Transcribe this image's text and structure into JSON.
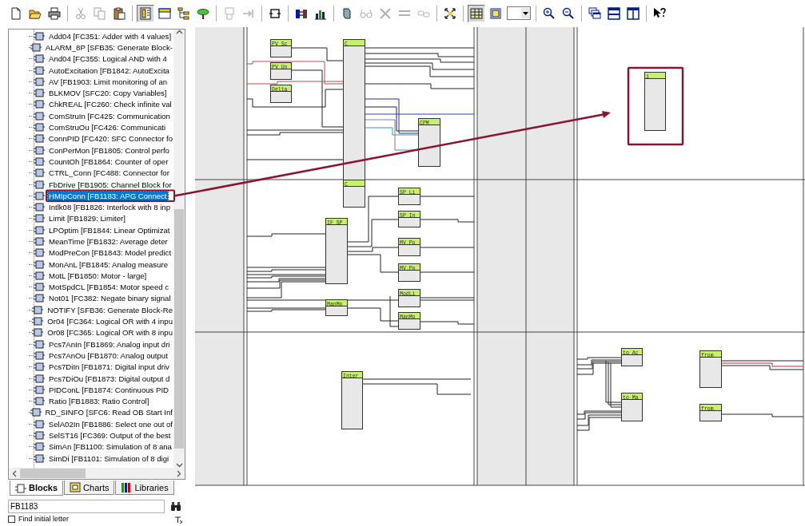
{
  "toolbar": [
    {
      "kind": "new",
      "disabled": false,
      "pressed": false
    },
    {
      "kind": "open",
      "disabled": false,
      "pressed": false
    },
    {
      "kind": "print",
      "disabled": false,
      "pressed": false
    },
    {
      "kind": "separator"
    },
    {
      "kind": "cut",
      "disabled": true,
      "pressed": false
    },
    {
      "kind": "copy",
      "disabled": true,
      "pressed": false
    },
    {
      "kind": "paste",
      "disabled": false,
      "pressed": false
    },
    {
      "kind": "separator"
    },
    {
      "kind": "catalog",
      "disabled": false,
      "pressed": true
    },
    {
      "kind": "window",
      "disabled": false,
      "pressed": false
    },
    {
      "kind": "tree",
      "disabled": false,
      "pressed": false
    },
    {
      "kind": "pin",
      "disabled": false,
      "pressed": false
    },
    {
      "kind": "separator"
    },
    {
      "kind": "stamp",
      "disabled": true,
      "pressed": false
    },
    {
      "kind": "arrowbar",
      "disabled": true,
      "pressed": false
    },
    {
      "kind": "separator"
    },
    {
      "kind": "loop",
      "disabled": false,
      "pressed": false
    },
    {
      "kind": "separator"
    },
    {
      "kind": "connector",
      "disabled": false,
      "pressed": false
    },
    {
      "kind": "chart",
      "disabled": false,
      "pressed": false
    },
    {
      "kind": "separator"
    },
    {
      "kind": "eraser",
      "disabled": false,
      "pressed": false
    },
    {
      "kind": "glasses",
      "disabled": true,
      "pressed": false
    },
    {
      "kind": "cross",
      "disabled": true,
      "pressed": false
    },
    {
      "kind": "line",
      "disabled": true,
      "pressed": false
    },
    {
      "kind": "chain",
      "disabled": true,
      "pressed": false
    },
    {
      "kind": "separator"
    },
    {
      "kind": "expand",
      "disabled": false,
      "pressed": false
    },
    {
      "kind": "separator"
    },
    {
      "kind": "table",
      "disabled": false,
      "pressed": true
    },
    {
      "kind": "sheet",
      "disabled": false,
      "pressed": false
    },
    {
      "kind": "dropdown"
    },
    {
      "kind": "separator"
    },
    {
      "kind": "zoomin",
      "disabled": false,
      "pressed": false
    },
    {
      "kind": "zoomout",
      "disabled": false,
      "pressed": false
    },
    {
      "kind": "separator"
    },
    {
      "kind": "cascade",
      "disabled": false,
      "pressed": false
    },
    {
      "kind": "hsplit",
      "disabled": false,
      "pressed": false
    },
    {
      "kind": "vsplit",
      "disabled": false,
      "pressed": false
    },
    {
      "kind": "separator"
    },
    {
      "kind": "help",
      "disabled": false,
      "pressed": false
    }
  ],
  "sidebar": {
    "tree": {
      "items": [
        {
          "label": "Add04  [FC351: Adder with 4 values]",
          "selected": false
        },
        {
          "label": "ALARM_8P  [SFB35: Generate Block-",
          "selected": false
        },
        {
          "label": "And04  [FC355: Logical AND with 4",
          "selected": false
        },
        {
          "label": "AutoExcitation  [FB1842: AutoExcita",
          "selected": false
        },
        {
          "label": "AV  [FB1903: Limit monitoring of an",
          "selected": false
        },
        {
          "label": "BLKMOV  [SFC20: Copy Variables]",
          "selected": false
        },
        {
          "label": "ChkREAL  [FC260: Check infinite val",
          "selected": false
        },
        {
          "label": "ComStruIn  [FC425: Communication",
          "selected": false
        },
        {
          "label": "ComStruOu  [FC426: Communicati",
          "selected": false
        },
        {
          "label": "ConnPID  [FC420: SFC Connector fo",
          "selected": false
        },
        {
          "label": "ConPerMon  [FB1805: Control perfo",
          "selected": false
        },
        {
          "label": "CountOh  [FB1864: Counter of oper",
          "selected": false
        },
        {
          "label": "CTRL_Conn  [FC488: Connector for",
          "selected": false
        },
        {
          "label": "FbDrive  [FB1905: Channel Block for",
          "selected": false
        },
        {
          "label": "HMIpConn  [FB1183: APG Connect",
          "selected": true
        },
        {
          "label": "Intlk08  [FB1826: Interlock with 8 inp",
          "selected": false
        },
        {
          "label": "Limit  [FB1829: Limiter]",
          "selected": false
        },
        {
          "label": "LPOptim  [FB1844: Linear Optimizat",
          "selected": false
        },
        {
          "label": "MeanTime  [FB1832: Average deter",
          "selected": false
        },
        {
          "label": "ModPreCon  [FB1843: Model predict",
          "selected": false
        },
        {
          "label": "MonAnL  [FB1845: Analog measure",
          "selected": false
        },
        {
          "label": "MotL  [FB1850: Motor - large]",
          "selected": false
        },
        {
          "label": "MotSpdCL  [FB1854: Motor speed c",
          "selected": false
        },
        {
          "label": "Not01  [FC382: Negate binary signal",
          "selected": false
        },
        {
          "label": "NOTIFY  [SFB36: Generate Block-Re",
          "selected": false
        },
        {
          "label": "Or04  [FC364: Logical OR with 4 inpu",
          "selected": false
        },
        {
          "label": "Or08  [FC365: Logical OR with 8 inpu",
          "selected": false
        },
        {
          "label": "Pcs7AnIn  [FB1869: Analog input dri",
          "selected": false
        },
        {
          "label": "Pcs7AnOu  [FB1870: Analog output",
          "selected": false
        },
        {
          "label": "Pcs7DiIn  [FB1871: Digital input driv",
          "selected": false
        },
        {
          "label": "Pcs7DiOu  [FB1873: Digital output d",
          "selected": false
        },
        {
          "label": "PIDConL  [FB1874: Continuous PID",
          "selected": false
        },
        {
          "label": "Ratio  [FB1883: Ratio Control]",
          "selected": false
        },
        {
          "label": "RD_SINFO  [SFC6: Read OB Start Inf",
          "selected": false
        },
        {
          "label": "SelA02In  [FB1886: Select one out of",
          "selected": false
        },
        {
          "label": "SelST16  [FC369: Output of the best",
          "selected": false
        },
        {
          "label": "SimAn  [FB1100: Simulation of 8 ana",
          "selected": false
        },
        {
          "label": "SimDi  [FB1101: Simulation of 8 digi",
          "selected": false
        }
      ]
    },
    "tabs": [
      {
        "label": "Blocks",
        "kind": "blocks",
        "selected": true
      },
      {
        "label": "Charts",
        "kind": "charts",
        "selected": false
      },
      {
        "label": "Libraries",
        "kind": "libraries",
        "selected": false
      }
    ],
    "search": {
      "value": "FB1183"
    },
    "find_initial_letter": {
      "label": "Find initial letter",
      "checked": false
    }
  },
  "chart": {
    "blocks": [
      {
        "label": "PV_Sc"
      },
      {
        "label": "PV_Un"
      },
      {
        "label": "Delta"
      },
      {
        "label": "C"
      },
      {
        "label": "CPM"
      },
      {
        "label": "1"
      },
      {
        "label": "C"
      },
      {
        "label": "SP_Li"
      },
      {
        "label": "SP_In"
      },
      {
        "label": "IF_SP"
      },
      {
        "label": "MV_Po"
      },
      {
        "label": "MV_Po"
      },
      {
        "label": "ModLi"
      },
      {
        "label": "ManMo"
      },
      {
        "label": "ManMo"
      },
      {
        "label": "Inter"
      },
      {
        "label": "to_Ac"
      },
      {
        "label": "to_Ma"
      },
      {
        "label": "from"
      },
      {
        "label": "from"
      }
    ]
  }
}
